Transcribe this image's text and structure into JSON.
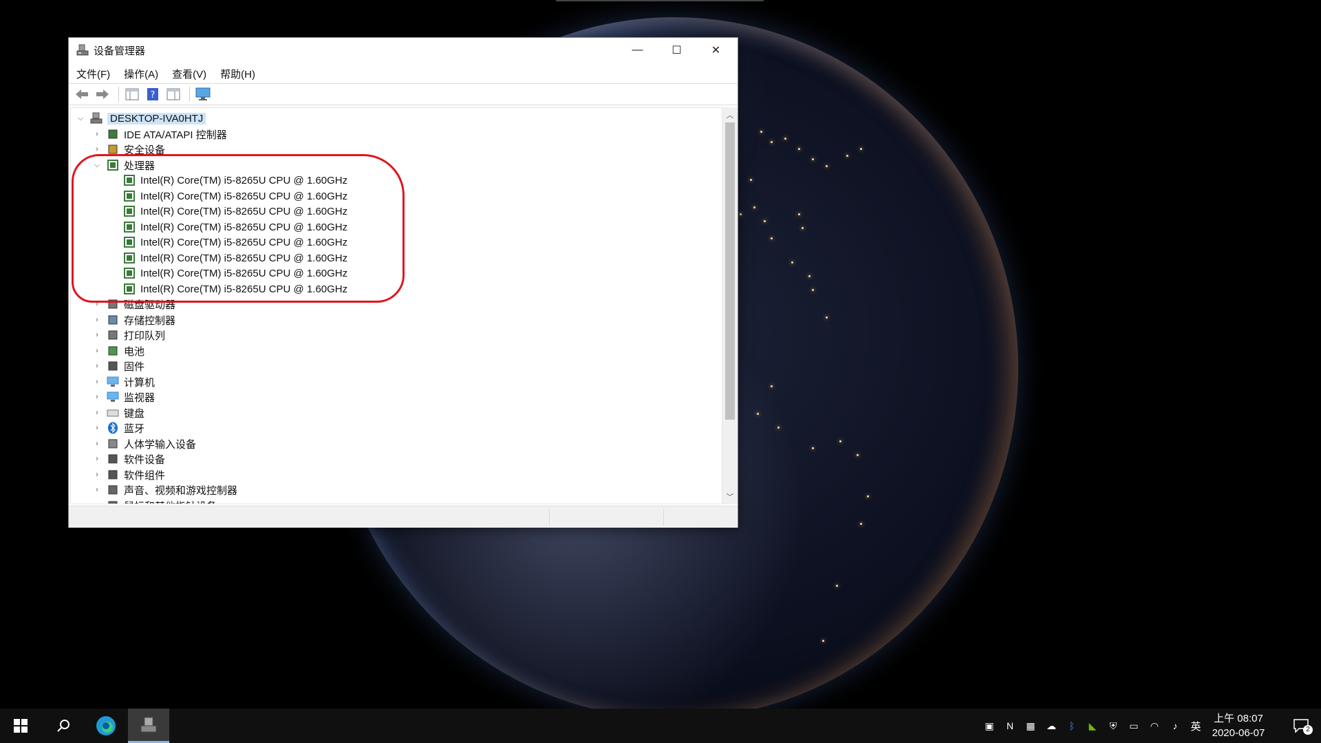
{
  "window": {
    "title": "设备管理器",
    "controls": {
      "minimize": "—",
      "maximize": "☐",
      "close": "✕"
    }
  },
  "menu": [
    "文件(F)",
    "操作(A)",
    "查看(V)",
    "帮助(H)"
  ],
  "toolbar": {
    "icons": [
      "back-arrow-icon",
      "forward-arrow-icon",
      "properties-icon",
      "help-icon",
      "view-icon",
      "monitor-icon"
    ]
  },
  "tree": {
    "root": "DESKTOP-IVA0HTJ",
    "categories_before": [
      {
        "label": "IDE ATA/ATAPI 控制器",
        "icon": "ide-controller-icon"
      },
      {
        "label": "安全设备",
        "icon": "security-device-icon"
      }
    ],
    "expanded": {
      "label": "处理器",
      "icon": "processor-icon",
      "children": [
        "Intel(R) Core(TM) i5-8265U CPU @ 1.60GHz",
        "Intel(R) Core(TM) i5-8265U CPU @ 1.60GHz",
        "Intel(R) Core(TM) i5-8265U CPU @ 1.60GHz",
        "Intel(R) Core(TM) i5-8265U CPU @ 1.60GHz",
        "Intel(R) Core(TM) i5-8265U CPU @ 1.60GHz",
        "Intel(R) Core(TM) i5-8265U CPU @ 1.60GHz",
        "Intel(R) Core(TM) i5-8265U CPU @ 1.60GHz",
        "Intel(R) Core(TM) i5-8265U CPU @ 1.60GHz"
      ]
    },
    "categories_after": [
      {
        "label": "磁盘驱动器",
        "icon": "disk-drive-icon"
      },
      {
        "label": "存储控制器",
        "icon": "storage-controller-icon"
      },
      {
        "label": "打印队列",
        "icon": "printer-icon"
      },
      {
        "label": "电池",
        "icon": "battery-icon"
      },
      {
        "label": "固件",
        "icon": "firmware-icon"
      },
      {
        "label": "计算机",
        "icon": "computer-icon"
      },
      {
        "label": "监视器",
        "icon": "monitor-icon"
      },
      {
        "label": "键盘",
        "icon": "keyboard-icon"
      },
      {
        "label": "蓝牙",
        "icon": "bluetooth-icon"
      },
      {
        "label": "人体学输入设备",
        "icon": "hid-icon"
      },
      {
        "label": "软件设备",
        "icon": "software-device-icon"
      },
      {
        "label": "软件组件",
        "icon": "software-component-icon"
      },
      {
        "label": "声音、视频和游戏控制器",
        "icon": "audio-icon"
      },
      {
        "label": "鼠标和其他指针设备",
        "icon": "mouse-icon"
      }
    ]
  },
  "taskbar": {
    "apps": [
      "start-icon",
      "search-icon",
      "edge-icon",
      "device-manager-icon"
    ],
    "tray": [
      "network-app-icon",
      "onenote-icon",
      "color-app-icon",
      "cloud-icon",
      "bluetooth-icon",
      "nvidia-icon",
      "defender-icon",
      "battery-icon",
      "wifi-icon",
      "volume-icon"
    ],
    "ime": "英",
    "time": "上午 08:07",
    "date": "2020-06-07",
    "notification_count": "2"
  },
  "colors": {
    "annotation": "#e0141e",
    "selection": "#cce4f7",
    "taskbar": "#101010"
  }
}
